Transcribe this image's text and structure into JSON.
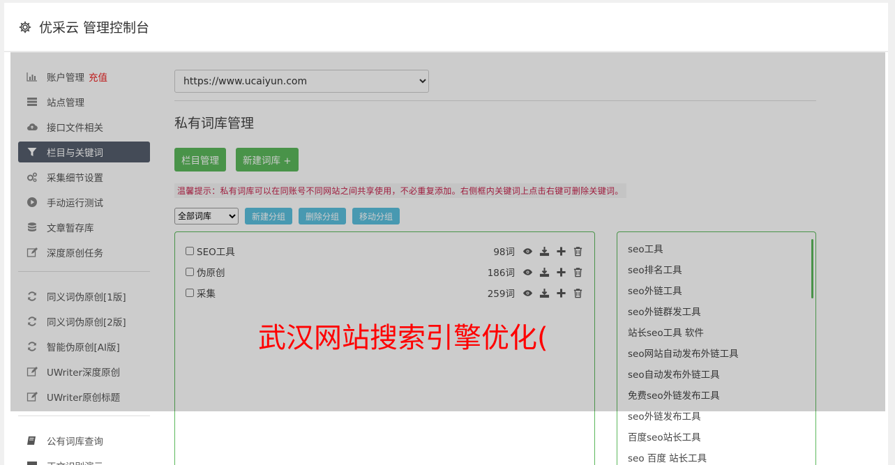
{
  "header": {
    "title": "优采云 管理控制台",
    "icon": "gear-icon"
  },
  "sidebar": {
    "group1": [
      {
        "label": "账户管理",
        "badge": "充值",
        "icon": "bar-chart-icon"
      },
      {
        "label": "站点管理",
        "icon": "server-icon"
      },
      {
        "label": "接口文件相关",
        "icon": "cloud-upload-icon"
      },
      {
        "label": "栏目与关键词",
        "icon": "filter-icon",
        "active": true
      },
      {
        "label": "采集细节设置",
        "icon": "gears-icon"
      },
      {
        "label": "手动运行测试",
        "icon": "play-circle-icon"
      },
      {
        "label": "文章暂存库",
        "icon": "database-icon"
      },
      {
        "label": "深度原创任务",
        "icon": "edit-icon"
      }
    ],
    "group2": [
      {
        "label": "同义词伪原创[1版]",
        "icon": "refresh-icon"
      },
      {
        "label": "同义词伪原创[2版]",
        "icon": "refresh-icon"
      },
      {
        "label": "智能伪原创[AI版]",
        "icon": "refresh-icon"
      },
      {
        "label": "UWriter深度原创",
        "icon": "edit-icon"
      },
      {
        "label": "UWriter原创标题",
        "icon": "edit-icon"
      }
    ],
    "group3": [
      {
        "label": "公有词库查询",
        "icon": "book-icon"
      },
      {
        "label": "正文识别演示",
        "icon": "monitor-icon"
      }
    ]
  },
  "content": {
    "site_select": {
      "value": "https://www.ucaiyun.com"
    },
    "page_title": "私有词库管理",
    "buttons": {
      "columns": "栏目管理",
      "new_lib": "新建词库 +"
    },
    "tip": "温馨提示：私有词库可以在同账号不同网站之间共享使用，不必重复添加。右侧框内关键词上点击右键可删除关键词。",
    "group_select": {
      "value": "全部词库"
    },
    "group_buttons": {
      "new": "新建分组",
      "delete": "删除分组",
      "move": "移动分组"
    },
    "libraries": [
      {
        "name": "SEO工具",
        "count": "98词"
      },
      {
        "name": "伪原创",
        "count": "186词"
      },
      {
        "name": "采集",
        "count": "259词"
      }
    ],
    "keywords": [
      "seo工具",
      "seo排名工具",
      "seo外链工具",
      "seo外链群发工具",
      "站长seo工具 软件",
      "seo网站自动发布外链工具",
      "seo自动发布外链工具",
      "免费seo外链发布工具",
      "seo外链发布工具",
      "百度seo站长工具",
      "seo 百度 站长工具"
    ]
  },
  "watermark": "武汉网站搜索引擎优化(",
  "colors": {
    "accent_green": "#5cb85c",
    "accent_blue": "#5bc0de",
    "active_nav": "#555e6d",
    "badge_red": "#e22",
    "watermark_red": "#ff0000"
  }
}
